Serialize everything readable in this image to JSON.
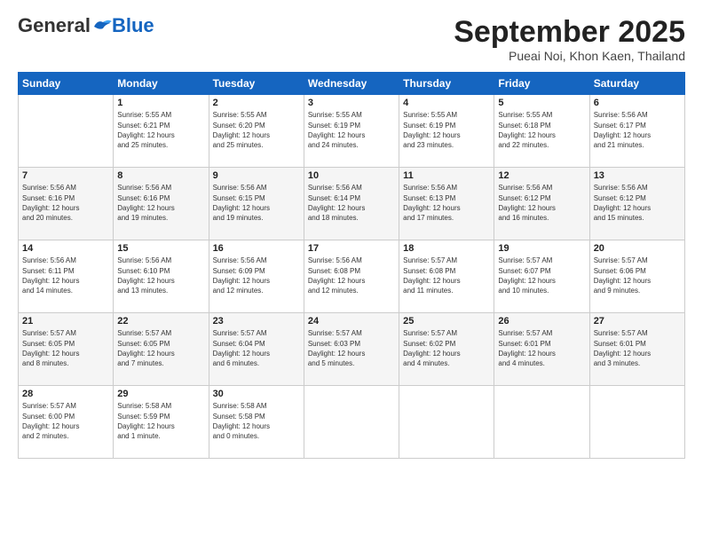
{
  "logo": {
    "general": "General",
    "blue": "Blue"
  },
  "header": {
    "month": "September 2025",
    "location": "Pueai Noi, Khon Kaen, Thailand"
  },
  "weekdays": [
    "Sunday",
    "Monday",
    "Tuesday",
    "Wednesday",
    "Thursday",
    "Friday",
    "Saturday"
  ],
  "weeks": [
    [
      {
        "day": "",
        "info": ""
      },
      {
        "day": "1",
        "info": "Sunrise: 5:55 AM\nSunset: 6:21 PM\nDaylight: 12 hours\nand 25 minutes."
      },
      {
        "day": "2",
        "info": "Sunrise: 5:55 AM\nSunset: 6:20 PM\nDaylight: 12 hours\nand 25 minutes."
      },
      {
        "day": "3",
        "info": "Sunrise: 5:55 AM\nSunset: 6:19 PM\nDaylight: 12 hours\nand 24 minutes."
      },
      {
        "day": "4",
        "info": "Sunrise: 5:55 AM\nSunset: 6:19 PM\nDaylight: 12 hours\nand 23 minutes."
      },
      {
        "day": "5",
        "info": "Sunrise: 5:55 AM\nSunset: 6:18 PM\nDaylight: 12 hours\nand 22 minutes."
      },
      {
        "day": "6",
        "info": "Sunrise: 5:56 AM\nSunset: 6:17 PM\nDaylight: 12 hours\nand 21 minutes."
      }
    ],
    [
      {
        "day": "7",
        "info": "Sunrise: 5:56 AM\nSunset: 6:16 PM\nDaylight: 12 hours\nand 20 minutes."
      },
      {
        "day": "8",
        "info": "Sunrise: 5:56 AM\nSunset: 6:16 PM\nDaylight: 12 hours\nand 19 minutes."
      },
      {
        "day": "9",
        "info": "Sunrise: 5:56 AM\nSunset: 6:15 PM\nDaylight: 12 hours\nand 19 minutes."
      },
      {
        "day": "10",
        "info": "Sunrise: 5:56 AM\nSunset: 6:14 PM\nDaylight: 12 hours\nand 18 minutes."
      },
      {
        "day": "11",
        "info": "Sunrise: 5:56 AM\nSunset: 6:13 PM\nDaylight: 12 hours\nand 17 minutes."
      },
      {
        "day": "12",
        "info": "Sunrise: 5:56 AM\nSunset: 6:12 PM\nDaylight: 12 hours\nand 16 minutes."
      },
      {
        "day": "13",
        "info": "Sunrise: 5:56 AM\nSunset: 6:12 PM\nDaylight: 12 hours\nand 15 minutes."
      }
    ],
    [
      {
        "day": "14",
        "info": "Sunrise: 5:56 AM\nSunset: 6:11 PM\nDaylight: 12 hours\nand 14 minutes."
      },
      {
        "day": "15",
        "info": "Sunrise: 5:56 AM\nSunset: 6:10 PM\nDaylight: 12 hours\nand 13 minutes."
      },
      {
        "day": "16",
        "info": "Sunrise: 5:56 AM\nSunset: 6:09 PM\nDaylight: 12 hours\nand 12 minutes."
      },
      {
        "day": "17",
        "info": "Sunrise: 5:56 AM\nSunset: 6:08 PM\nDaylight: 12 hours\nand 12 minutes."
      },
      {
        "day": "18",
        "info": "Sunrise: 5:57 AM\nSunset: 6:08 PM\nDaylight: 12 hours\nand 11 minutes."
      },
      {
        "day": "19",
        "info": "Sunrise: 5:57 AM\nSunset: 6:07 PM\nDaylight: 12 hours\nand 10 minutes."
      },
      {
        "day": "20",
        "info": "Sunrise: 5:57 AM\nSunset: 6:06 PM\nDaylight: 12 hours\nand 9 minutes."
      }
    ],
    [
      {
        "day": "21",
        "info": "Sunrise: 5:57 AM\nSunset: 6:05 PM\nDaylight: 12 hours\nand 8 minutes."
      },
      {
        "day": "22",
        "info": "Sunrise: 5:57 AM\nSunset: 6:05 PM\nDaylight: 12 hours\nand 7 minutes."
      },
      {
        "day": "23",
        "info": "Sunrise: 5:57 AM\nSunset: 6:04 PM\nDaylight: 12 hours\nand 6 minutes."
      },
      {
        "day": "24",
        "info": "Sunrise: 5:57 AM\nSunset: 6:03 PM\nDaylight: 12 hours\nand 5 minutes."
      },
      {
        "day": "25",
        "info": "Sunrise: 5:57 AM\nSunset: 6:02 PM\nDaylight: 12 hours\nand 4 minutes."
      },
      {
        "day": "26",
        "info": "Sunrise: 5:57 AM\nSunset: 6:01 PM\nDaylight: 12 hours\nand 4 minutes."
      },
      {
        "day": "27",
        "info": "Sunrise: 5:57 AM\nSunset: 6:01 PM\nDaylight: 12 hours\nand 3 minutes."
      }
    ],
    [
      {
        "day": "28",
        "info": "Sunrise: 5:57 AM\nSunset: 6:00 PM\nDaylight: 12 hours\nand 2 minutes."
      },
      {
        "day": "29",
        "info": "Sunrise: 5:58 AM\nSunset: 5:59 PM\nDaylight: 12 hours\nand 1 minute."
      },
      {
        "day": "30",
        "info": "Sunrise: 5:58 AM\nSunset: 5:58 PM\nDaylight: 12 hours\nand 0 minutes."
      },
      {
        "day": "",
        "info": ""
      },
      {
        "day": "",
        "info": ""
      },
      {
        "day": "",
        "info": ""
      },
      {
        "day": "",
        "info": ""
      }
    ]
  ]
}
